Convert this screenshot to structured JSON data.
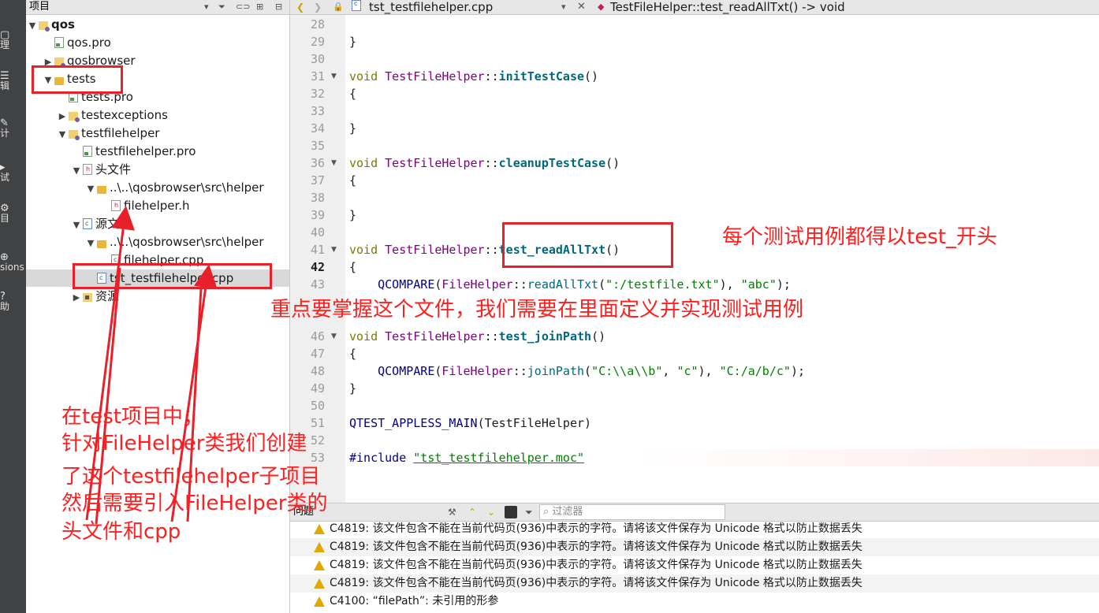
{
  "mode_bar": {
    "items": [
      {
        "label": "理"
      },
      {
        "label": "辑"
      },
      {
        "label": "计"
      },
      {
        "label": "试"
      },
      {
        "label": "目"
      },
      {
        "label": "sions"
      },
      {
        "label": "助"
      }
    ]
  },
  "project_panel": {
    "title": "项目",
    "tree": [
      {
        "label": "qos",
        "bold": true
      },
      {
        "label": "qos.pro"
      },
      {
        "label": "qosbrowser"
      },
      {
        "label": "tests"
      },
      {
        "label": "tests.pro"
      },
      {
        "label": "testexceptions"
      },
      {
        "label": "testfilehelper"
      },
      {
        "label": "testfilehelper.pro"
      },
      {
        "label": "头文件"
      },
      {
        "label": "..\\..\\qosbrowser\\src\\helper"
      },
      {
        "label": "filehelper.h"
      },
      {
        "label": "源文件"
      },
      {
        "label": "..\\..\\qosbrowser\\src\\helper"
      },
      {
        "label": "filehelper.cpp"
      },
      {
        "label": "tst_testfilehelper.cpp"
      },
      {
        "label": "资源"
      }
    ]
  },
  "editor": {
    "file_tab": "tst_testfilehelper.cpp",
    "function_crumb": "TestFileHelper::test_readAllTxt() -> void",
    "current_line": 42,
    "line_numbers": [
      "28",
      "29",
      "30",
      "31",
      "32",
      "33",
      "34",
      "35",
      "36",
      "37",
      "38",
      "39",
      "40",
      "41",
      "42",
      "43",
      "",
      "46",
      "47",
      "48",
      "49",
      "50",
      "51",
      "52",
      "53"
    ]
  },
  "code": {
    "class": "TestFileHelper",
    "sep": "::",
    "void": "void",
    "brace_open": "{",
    "brace_close": "}",
    "paren": "()",
    "init": "initTestCase",
    "cleanup": "cleanupTestCase",
    "read": "test_readAllTxt",
    "join": "test_joinPath",
    "qcompare": "QCOMPARE",
    "fh": "FileHelper",
    "readAllTxt": "readAllTxt",
    "joinPath": "joinPath",
    "s_testfile": "\":/testfile.txt\"",
    "s_abc": "\"abc\"",
    "s_path1": "\"C:\\\\a\\\\b\"",
    "s_c": "\"c\"",
    "s_path2": "\"C:/a/b/c\"",
    "main_macro": "QTEST_APPLESS_MAIN",
    "main_arg": "(TestFileHelper)",
    "include": "#include",
    "moc": "\"tst_testfilehelper.moc\""
  },
  "issues": {
    "title": "问题",
    "filter_placeholder": "过滤器",
    "items": [
      "C4819: 该文件包含不能在当前代码页(936)中表示的字符。请将该文件保存为 Unicode 格式以防止数据丢失",
      "C4819: 该文件包含不能在当前代码页(936)中表示的字符。请将该文件保存为 Unicode 格式以防止数据丢失",
      "C4819: 该文件包含不能在当前代码页(936)中表示的字符。请将该文件保存为 Unicode 格式以防止数据丢失",
      "C4819: 该文件包含不能在当前代码页(936)中表示的字符。请将该文件保存为 Unicode 格式以防止数据丢失",
      "C4100: “filePath”: 未引用的形参"
    ]
  },
  "annotations": {
    "prefix_note": "每个测试用例都得以test_开头",
    "file_note": "重点要掌握这个文件，我们需要在里面定义并实现测试用例",
    "left_note": [
      "在test项目中；",
      "针对FileHelper类我们创建",
      "了这个testfilehelper子项目",
      "然后需要引入FileHelper类的",
      "头文件和cpp"
    ]
  },
  "colors": {
    "annotation_red": "#ff1f1f",
    "mode_bar_bg": "#404244",
    "warning": "#e0a800"
  }
}
